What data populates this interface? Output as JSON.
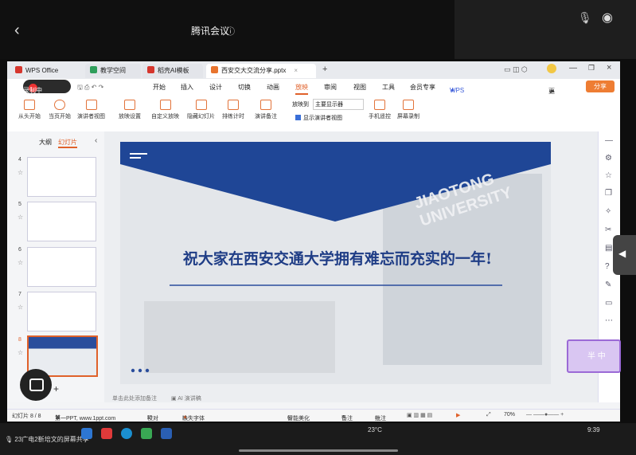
{
  "meeting": {
    "title": "腾讯会议",
    "info_icon": "info-icon"
  },
  "tabs": [
    {
      "label": "WPS Office",
      "color": "#d6362d"
    },
    {
      "label": "教学空间",
      "color": "#2f9e5b"
    },
    {
      "label": "稻壳AI模板",
      "color": "#d6362d"
    },
    {
      "label": "西安交大交流分享.pptx",
      "color": "#e8742f"
    }
  ],
  "recording": "录制中",
  "menu": [
    "开始",
    "插入",
    "设计",
    "切换",
    "动画",
    "放映",
    "审阅",
    "视图",
    "工具",
    "会员专享",
    "WPS AI"
  ],
  "menu_right": {
    "unsaved": "更新失败",
    "share": "分享"
  },
  "ribbon": {
    "buttons": [
      "从头开始",
      "当页开始",
      "演讲者视图",
      "放映设置",
      "自定义放映",
      "隐藏幻灯片",
      "排练计时",
      "演讲备注",
      "手机遥控",
      "屏幕录制"
    ],
    "screen_label": "放映到",
    "screen_value": "主要显示器",
    "presenter_check": "显示演讲者视图"
  },
  "left_panel": {
    "tab_outline": "大纲",
    "tab_slides": "幻灯片",
    "slides": [
      "4",
      "5",
      "6",
      "7",
      "8"
    ]
  },
  "slide": {
    "title": "祝大家在西安交通大学拥有难忘而充实的一年!",
    "watermark": "JIAOTONG UNIVERSITY"
  },
  "notes": {
    "placeholder": "单击此处添加备注",
    "ai": "AI 演讲稿"
  },
  "status": {
    "slide_count": "幻灯片 8 / 8",
    "theme": "第一PPT, www.1ppt.com",
    "proof": "校对",
    "missing_font": "缺失字体",
    "smart": "智能美化",
    "notes": "备注",
    "comments": "批注",
    "zoom": "70%"
  },
  "sticker": "半 中",
  "taskbar": {
    "share": "23广电2靳培文的屏幕共享",
    "weather": "23°C",
    "time": "9:39"
  }
}
